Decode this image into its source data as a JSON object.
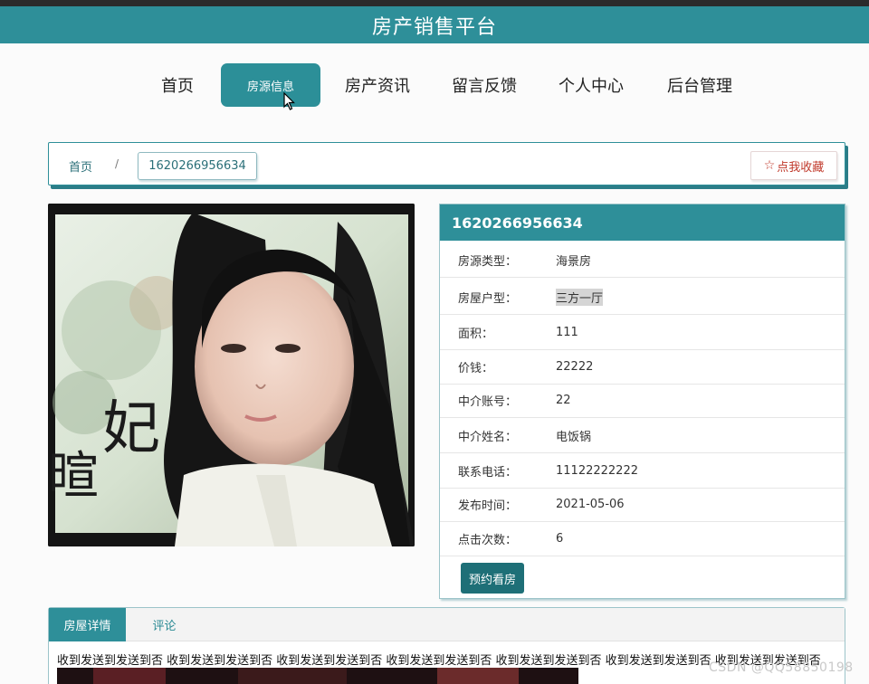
{
  "header": {
    "title": "房产销售平台"
  },
  "nav": {
    "items": [
      {
        "label": "首页"
      },
      {
        "label": "房源信息"
      },
      {
        "label": "房产资讯"
      },
      {
        "label": "留言反馈"
      },
      {
        "label": "个人中心"
      },
      {
        "label": "后台管理"
      }
    ]
  },
  "breadcrumb": {
    "home": "首页",
    "separator": "/",
    "current": "1620266956634"
  },
  "favorite": {
    "icon": "star-outline-icon",
    "label": "点我收藏"
  },
  "listing": {
    "title": "1620266956634",
    "fields": [
      {
        "key": "房源类型：",
        "value": "海景房"
      },
      {
        "key": "房屋户型：",
        "value": "三方一厅"
      },
      {
        "key": "面积：",
        "value": "111"
      },
      {
        "key": "价钱：",
        "value": "22222"
      },
      {
        "key": "中介账号：",
        "value": "22"
      },
      {
        "key": "中介姓名：",
        "value": "电饭锅"
      },
      {
        "key": "联系电话：",
        "value": "11122222222"
      },
      {
        "key": "发布时间：",
        "value": "2021-05-06"
      },
      {
        "key": "点击次数：",
        "value": "6"
      }
    ],
    "book_button": "预约看房"
  },
  "photo": {
    "calligraphy": "妃暄"
  },
  "tabs": {
    "detail": "房屋详情",
    "comments": "评论"
  },
  "detail": {
    "text": "收到发送到发送到否 收到发送到发送到否 收到发送到发送到否 收到发送到发送到否 收到发送到发送到否 收到发送到发送到否 收到发送到发送到否"
  },
  "watermark": "CSDN @QQ58850198",
  "colors": {
    "primary": "#2e8f99",
    "dark_button": "#1e6f77",
    "favorite_red": "#c0392b"
  }
}
